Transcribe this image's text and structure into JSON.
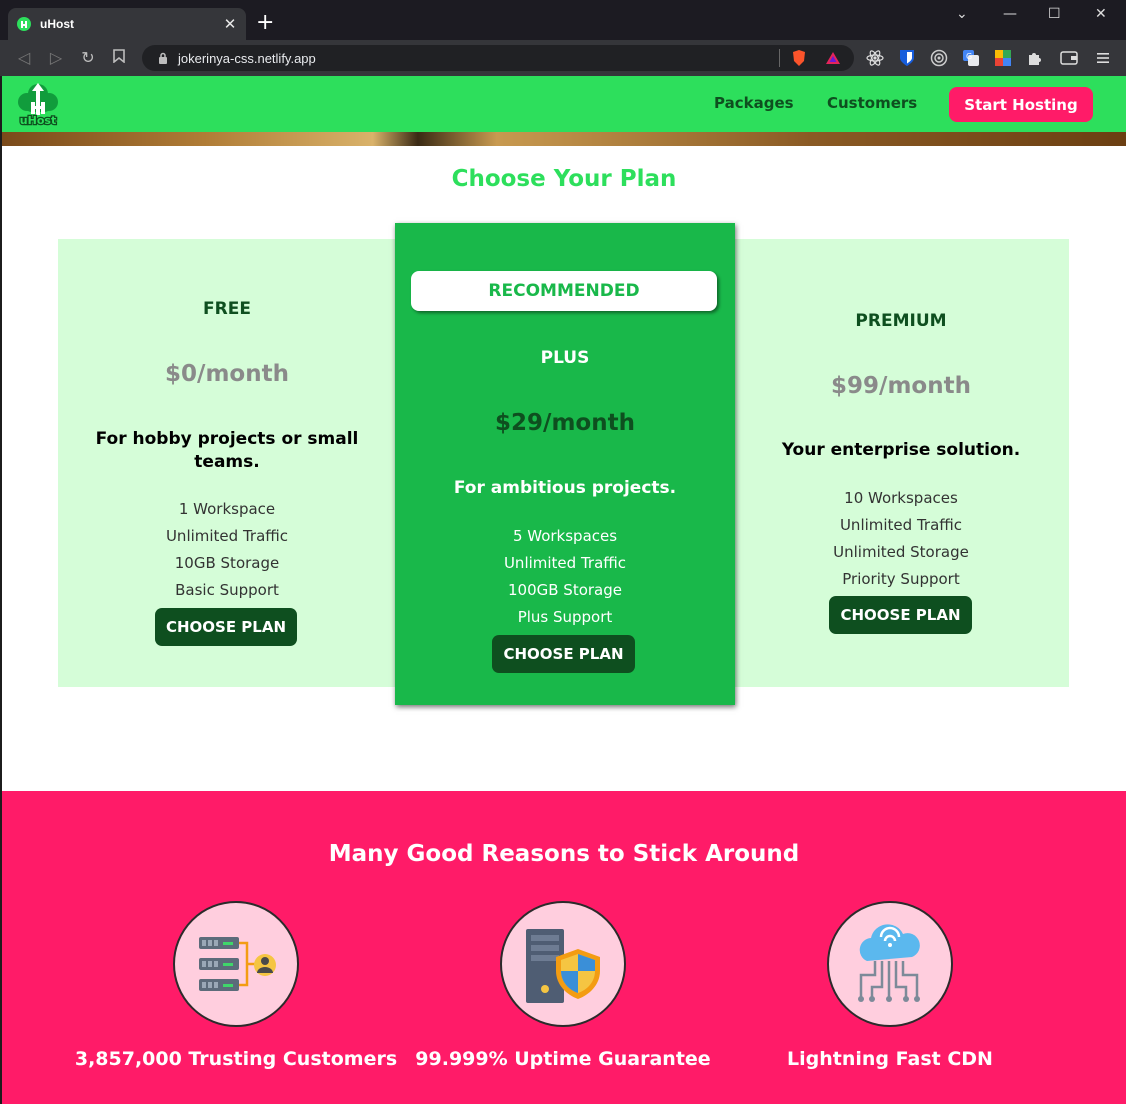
{
  "browser": {
    "tab_title": "uHost",
    "tab_close": "✕",
    "new_tab": "+",
    "url": "jokerinya-css.netlify.app",
    "window_controls": {
      "menu": "⌄",
      "minimize": "—",
      "maximize": "☐",
      "close": "✕"
    }
  },
  "header": {
    "logo_text": "uHost",
    "nav": {
      "packages": "Packages",
      "customers": "Customers"
    },
    "cta": "Start Hosting"
  },
  "plans": {
    "title": "Choose Your Plan",
    "free": {
      "name": "FREE",
      "price": "$0/month",
      "description": "For hobby projects or small teams.",
      "features": [
        "1 Workspace",
        "Unlimited Traffic",
        "10GB Storage",
        "Basic Support"
      ],
      "button": "CHOOSE PLAN"
    },
    "plus": {
      "badge": "RECOMMENDED",
      "name": "PLUS",
      "price": "$29/month",
      "description": "For ambitious projects.",
      "features": [
        "5 Workspaces",
        "Unlimited Traffic",
        "100GB Storage",
        "Plus Support"
      ],
      "button": "CHOOSE PLAN"
    },
    "premium": {
      "name": "PREMIUM",
      "price": "$99/month",
      "description": "Your enterprise solution.",
      "features": [
        "10 Workspaces",
        "Unlimited Traffic",
        "Unlimited Storage",
        "Priority Support"
      ],
      "button": "CHOOSE PLAN"
    }
  },
  "reasons": {
    "title": "Many Good Reasons to Stick Around",
    "items": [
      {
        "label": "3,857,000 Trusting Customers",
        "icon": "servers-customer-icon"
      },
      {
        "label": "99.999% Uptime Guarantee",
        "icon": "server-shield-icon"
      },
      {
        "label": "Lightning Fast CDN",
        "icon": "cloud-network-icon"
      }
    ]
  },
  "colors": {
    "brand_green": "#2ddf5c",
    "dark_green": "#0e4f1f",
    "plus_green": "#19b84a",
    "plan_bg": "#d5fdd8",
    "accent_pink": "#ff1b68"
  }
}
